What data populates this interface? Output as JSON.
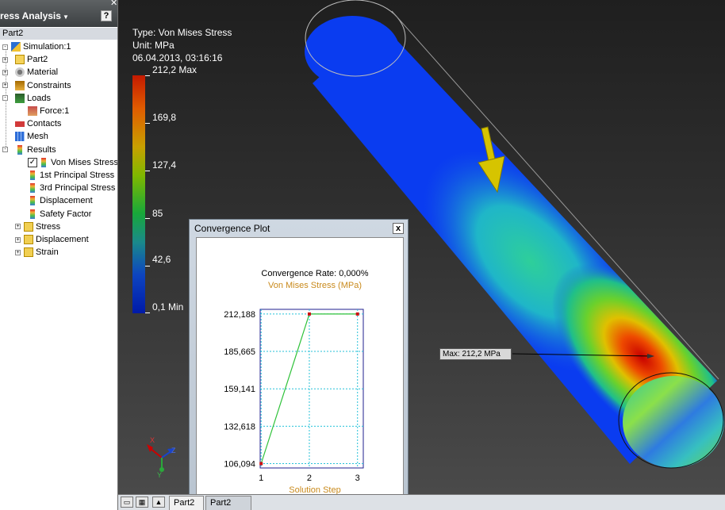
{
  "browser": {
    "title": "tress Analysis",
    "help_icon": "?",
    "root_item": "Part2",
    "tree": [
      {
        "label": "Simulation:1",
        "icon": "simulation-icon"
      },
      {
        "label": "Part2",
        "icon": "part-icon"
      },
      {
        "label": "Material",
        "icon": "material-icon"
      },
      {
        "label": "Constraints",
        "icon": "constraints-icon"
      },
      {
        "label": "Loads",
        "icon": "loads-icon"
      },
      {
        "label": "Force:1",
        "icon": "force-icon"
      },
      {
        "label": "Contacts",
        "icon": "contacts-icon"
      },
      {
        "label": "Mesh",
        "icon": "mesh-icon"
      },
      {
        "label": "Results",
        "icon": "results-icon"
      },
      {
        "label": "Von Mises Stress",
        "icon": "result-icon",
        "checked": true
      },
      {
        "label": "1st Principal Stress",
        "icon": "result-icon"
      },
      {
        "label": "3rd Principal Stress",
        "icon": "result-icon"
      },
      {
        "label": "Displacement",
        "icon": "result-icon"
      },
      {
        "label": "Safety Factor",
        "icon": "result-icon"
      },
      {
        "label": "Stress",
        "icon": "folder-icon"
      },
      {
        "label": "Displacement",
        "icon": "folder-icon"
      },
      {
        "label": "Strain",
        "icon": "folder-icon"
      }
    ]
  },
  "legend": {
    "type_line": "Type: Von Mises Stress",
    "unit_line": "Unit: MPa",
    "date_line": "06.04.2013, 03:16:16",
    "ticks": [
      "212,2 Max",
      "169,8",
      "127,4",
      "85",
      "42,6",
      "0,1 Min"
    ]
  },
  "max_label": "Max: 212,2 MPa",
  "convergence": {
    "dialog_title": "Convergence Plot",
    "close": "x"
  },
  "chart_data": {
    "type": "line",
    "title": "Convergence Rate: 0,000%",
    "subtitle": "Von Mises Stress (MPa)",
    "xlabel": "Solution Step",
    "categories": [
      "1",
      "2",
      "3"
    ],
    "x": [
      1,
      2,
      3
    ],
    "values": [
      106.094,
      212.188,
      212.188
    ],
    "y_ticks": [
      "212,188",
      "185,665",
      "159,141",
      "132,618",
      "106,094"
    ],
    "y_tick_values": [
      212.188,
      185.665,
      159.141,
      132.618,
      106.094
    ],
    "xlim": [
      0.98,
      3.12
    ],
    "ylim": [
      103.0,
      215.5
    ],
    "grid": true,
    "colors": {
      "line": "#2fc23a",
      "point": "#cc1111",
      "axis": "#1f1f8f",
      "grid": "#26c2d9",
      "label": "#c98a1c"
    }
  },
  "tabs": {
    "doc1": "Part2",
    "doc2": "Part2"
  }
}
